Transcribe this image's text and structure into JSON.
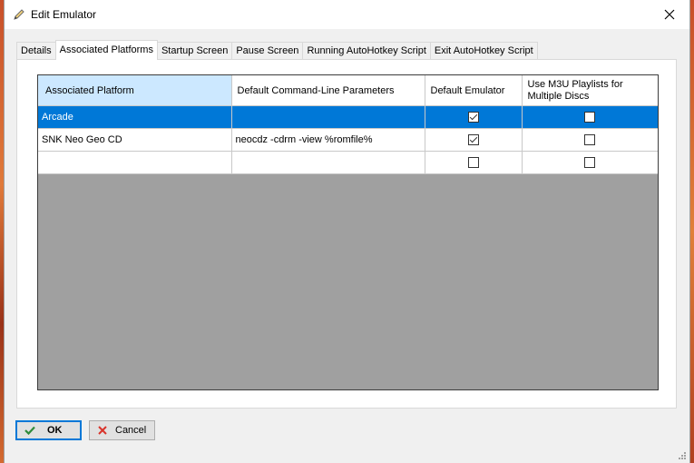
{
  "window": {
    "title": "Edit Emulator"
  },
  "tabs": [
    {
      "label": "Details",
      "active": false
    },
    {
      "label": "Associated Platforms",
      "active": true
    },
    {
      "label": "Startup Screen",
      "active": false
    },
    {
      "label": "Pause Screen",
      "active": false
    },
    {
      "label": "Running AutoHotkey Script",
      "active": false
    },
    {
      "label": "Exit AutoHotkey Script",
      "active": false
    }
  ],
  "grid": {
    "columns": [
      "Associated Platform",
      "Default Command-Line Parameters",
      "Default Emulator",
      "Use M3U Playlists for Multiple Discs"
    ],
    "rows": [
      {
        "platform": "Arcade",
        "params": "",
        "default_emulator": true,
        "use_m3u": false,
        "selected": true
      },
      {
        "platform": "SNK Neo Geo CD",
        "params": "neocdz -cdrm -view %romfile%",
        "default_emulator": true,
        "use_m3u": false,
        "selected": false
      },
      {
        "platform": "",
        "params": "",
        "default_emulator": false,
        "use_m3u": false,
        "selected": false
      }
    ]
  },
  "buttons": {
    "ok_label": "OK",
    "cancel_label": "Cancel"
  },
  "colors": {
    "selection": "#0078d7",
    "header_selected": "#cce8ff",
    "grid_empty": "#a0a0a0",
    "ok_check": "#2e8b3a",
    "cancel_x": "#d9342b"
  }
}
